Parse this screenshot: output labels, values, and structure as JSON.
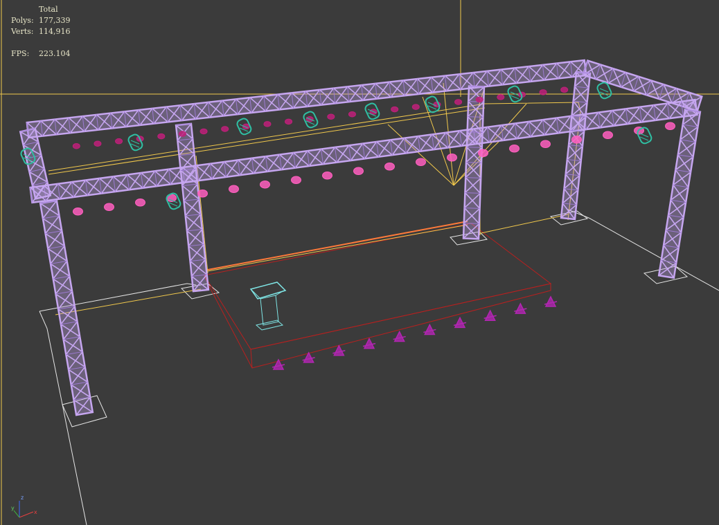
{
  "viewport": {
    "stats": {
      "total_label": "Total",
      "polys_label": "Polys:",
      "polys_value": "177,339",
      "verts_label": "Verts:",
      "verts_value": "114,916",
      "fps_label": "FPS:",
      "fps_value": "223.104"
    },
    "axis": {
      "x": "x",
      "y": "y",
      "z": "z"
    },
    "colors": {
      "background": "#3b3b3b",
      "truss": "#c6a6f0",
      "truss_dark": "#9d7ad3",
      "teal_light": "#2fbfa3",
      "pink_light": "#ff5fbf",
      "magenta_light": "#c0207a",
      "stage_outline": "#b8201f",
      "selection": "#f2c94c",
      "podium": "#7fe6e6",
      "floor_light": "#b226b2",
      "grid_white": "#e6e6e6"
    }
  }
}
